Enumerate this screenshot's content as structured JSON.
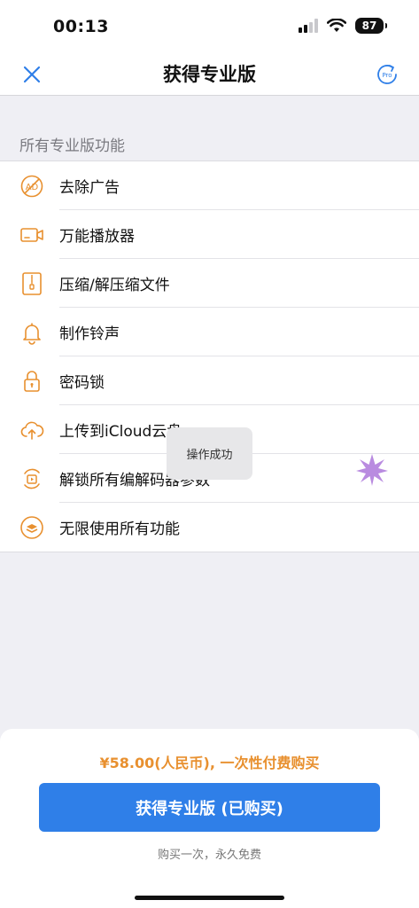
{
  "status_bar": {
    "time": "00:13",
    "battery": "87"
  },
  "nav": {
    "title": "获得专业版",
    "restore_badge": "Pro"
  },
  "section": {
    "header": "所有专业版功能"
  },
  "features": [
    {
      "label": "去除广告",
      "icon": "no-ads-icon"
    },
    {
      "label": "万能播放器",
      "icon": "video-camera-icon"
    },
    {
      "label": "压缩/解压缩文件",
      "icon": "zip-file-icon"
    },
    {
      "label": "制作铃声",
      "icon": "bell-icon"
    },
    {
      "label": "密码锁",
      "icon": "lock-icon"
    },
    {
      "label": "上传到iCloud云盘",
      "icon": "cloud-upload-icon"
    },
    {
      "label": "解锁所有编解码器参数",
      "icon": "codec-icon"
    },
    {
      "label": "无限使用所有功能",
      "icon": "layers-icon"
    }
  ],
  "toast": {
    "message": "操作成功"
  },
  "purchase": {
    "price": "¥58.00(人民币), 一次性付费购买",
    "button_label": "获得专业版 (已购买)",
    "note": "购买一次，永久免费"
  },
  "colors": {
    "accent": "#2f7fe8",
    "icon_orange": "#e8902f",
    "price_orange": "#e8902f"
  }
}
